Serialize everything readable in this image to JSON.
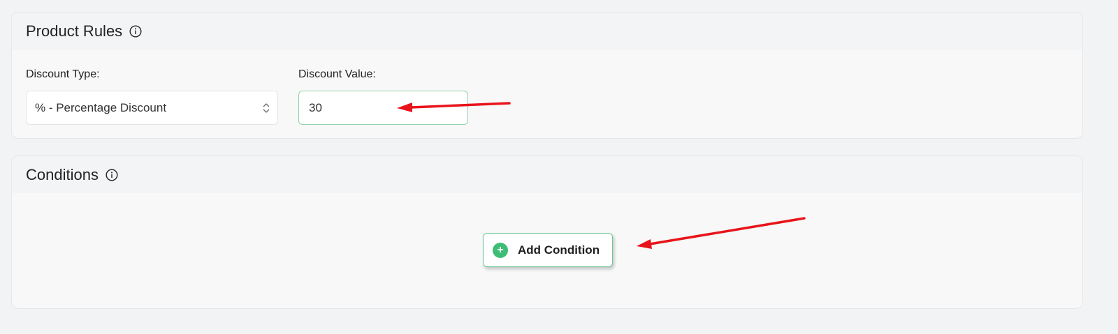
{
  "product_rules": {
    "title": "Product Rules",
    "info_icon": "info-circle-icon",
    "discount_type": {
      "label": "Discount Type:",
      "selected": "% - Percentage Discount",
      "chevron_icon": "up-down-chevron-icon"
    },
    "discount_value": {
      "label": "Discount Value:",
      "value": "30"
    }
  },
  "conditions": {
    "title": "Conditions",
    "info_icon": "info-circle-icon",
    "add_button": {
      "label": "Add Condition",
      "icon": "plus-circle-icon"
    }
  },
  "colors": {
    "page_bg": "#f2f3f5",
    "card_bg": "#f8f8f8",
    "header_bg": "#f3f4f6",
    "accent_green": "#3ebd74",
    "focus_border": "#8fd4a6",
    "annotation_red": "#e8141b"
  }
}
